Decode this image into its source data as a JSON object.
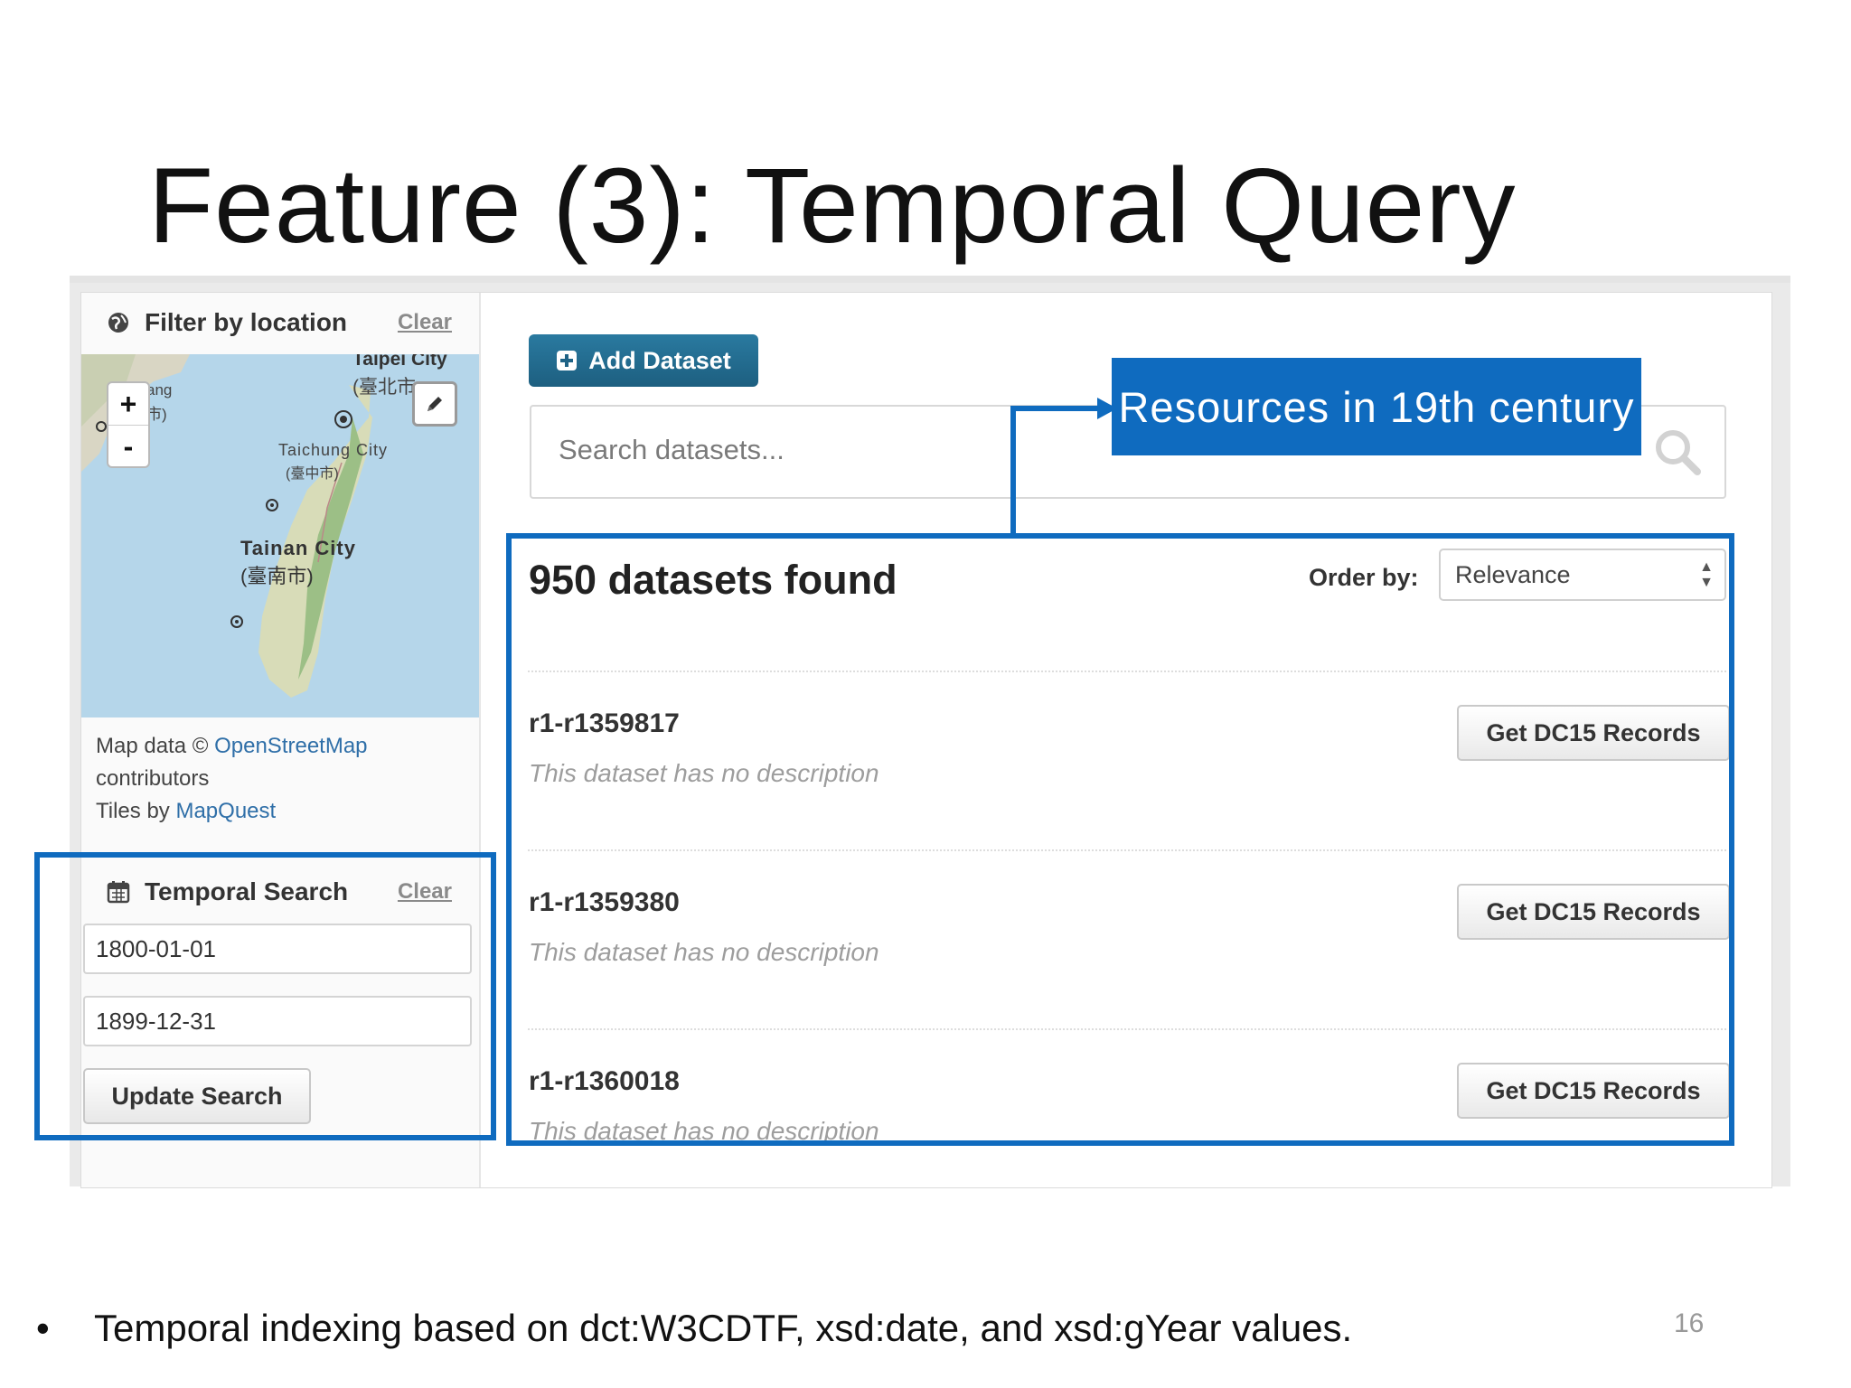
{
  "slide": {
    "title": "Feature (3): Temporal Query",
    "bullet_marker": "•",
    "bullet_text": "Temporal indexing based on dct:W3CDTF, xsd:date, and xsd:gYear values.",
    "page_number": "16"
  },
  "annotation": {
    "callout_text": "Resources in 19th century",
    "color": "#0f6bbf"
  },
  "sidebar": {
    "location_filter": {
      "title": "Filter by location",
      "clear_label": "Clear",
      "icon": "globe-icon"
    },
    "map": {
      "labels": {
        "taipei": "Taipei City",
        "taipei_zh": "(臺北市",
        "taichung": "Taichung City",
        "taichung_zh": "(臺中市)",
        "tainan": "Tainan City",
        "tainan_zh": "(臺南市)",
        "left_clip_top": "ang",
        "left_clip_bottom": "市)"
      },
      "zoom_in": "+",
      "zoom_out": "-",
      "attribution_prefix": "Map data © ",
      "attribution_osm": "OpenStreetMap",
      "attribution_contrib": "contributors",
      "attribution_tiles": "Tiles by ",
      "attribution_mapquest": "MapQuest"
    },
    "temporal": {
      "title": "Temporal Search",
      "clear_label": "Clear",
      "start_value": "1800-01-01",
      "end_value": "1899-12-31",
      "update_label": "Update Search",
      "icon": "calendar-icon"
    }
  },
  "main": {
    "add_dataset_label": "Add Dataset",
    "search_placeholder": "Search datasets...",
    "results_count_text": "950 datasets found",
    "order_by_label": "Order by:",
    "order_by_value": "Relevance",
    "datasets": [
      {
        "name": "r1-r1359817",
        "description": "This dataset has no description",
        "button": "Get DC15 Records"
      },
      {
        "name": "r1-r1359380",
        "description": "This dataset has no description",
        "button": "Get DC15 Records"
      },
      {
        "name": "r1-r1360018",
        "description": "This dataset has no description",
        "button": "Get DC15 Records"
      }
    ]
  }
}
